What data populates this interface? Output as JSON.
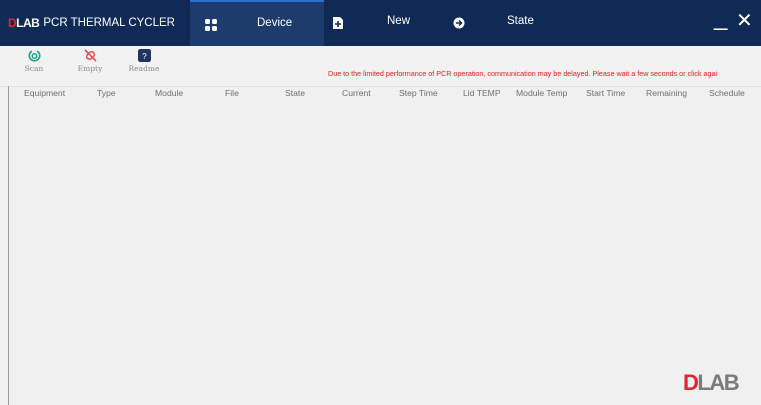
{
  "app": {
    "logo_text": "DLAB",
    "title": "PCR THERMAL CYCLER"
  },
  "nav": {
    "tabs": [
      {
        "label": "Device",
        "icon": "grid-icon",
        "active": true
      },
      {
        "label": "New",
        "icon": "new-file-icon",
        "active": false
      },
      {
        "label": "State",
        "icon": "arrow-circle-icon",
        "active": false
      }
    ]
  },
  "window": {
    "minimize": "_",
    "close": "✕"
  },
  "toolbar": {
    "scan_label": "Scan",
    "empty_label": "Empty",
    "readme_label": "Readme",
    "notice": "Due to the limited performance of PCR operation, communication may be delayed. Please wait a few seconds or click agai"
  },
  "table": {
    "columns": [
      "Equipment",
      "Type",
      "Module",
      "File",
      "State",
      "Current",
      "Step Time",
      "Lid TEMP",
      "Module Temp",
      "Start Time",
      "Remaining",
      "Schedule"
    ],
    "rows": []
  },
  "colors": {
    "titlebar": "#102a56",
    "accent_red": "#e32431",
    "notice_red": "#e02020",
    "scan_green": "#1aa68a",
    "panel": "#f0f0f0"
  }
}
